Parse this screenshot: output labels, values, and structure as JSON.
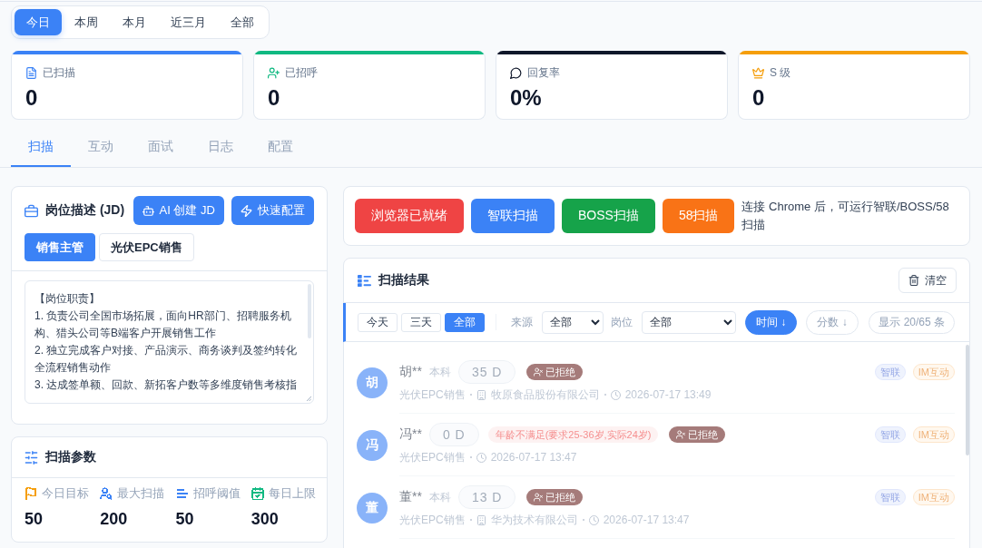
{
  "period_tabs": [
    {
      "label": "今日",
      "selected": true
    },
    {
      "label": "本周",
      "selected": false
    },
    {
      "label": "本月",
      "selected": false
    },
    {
      "label": "近三月",
      "selected": false
    },
    {
      "label": "全部",
      "selected": false
    }
  ],
  "stats": [
    {
      "label": "已扫描",
      "value": "0",
      "color": "#3b82f6"
    },
    {
      "label": "已招呼",
      "value": "0",
      "color": "#10b981"
    },
    {
      "label": "回复率",
      "value": "0%",
      "color": "#0f172a"
    },
    {
      "label": "S 级",
      "value": "0",
      "color": "#f59e0b"
    }
  ],
  "tabs": [
    {
      "label": "扫描",
      "selected": true
    },
    {
      "label": "互动",
      "selected": false
    },
    {
      "label": "面试",
      "selected": false
    },
    {
      "label": "日志",
      "selected": false
    },
    {
      "label": "配置",
      "selected": false
    }
  ],
  "jd_panel": {
    "title": "岗位描述 (JD)",
    "buttons": [
      "AI 创建 JD",
      "快速配置"
    ],
    "positions": [
      {
        "label": "销售主管",
        "selected": true
      },
      {
        "label": "光伏EPC销售",
        "selected": false
      }
    ],
    "description": "【岗位职责】\n1. 负责公司全国市场拓展，面向HR部门、招聘服务机构、猎头公司等B端客户开展销售工作\n2. 独立完成客户对接、产品演示、商务谈判及签约转化全流程销售动作\n3. 达成签单额、回款、新拓客户数等多维度销售考核指"
  },
  "scan_params": {
    "title": "扫描参数",
    "items": [
      {
        "label": "今日目标",
        "value": "50",
        "color": "#f59e0b"
      },
      {
        "label": "最大扫描",
        "value": "200",
        "color": "#3b82f6"
      },
      {
        "label": "招呼阈值",
        "value": "50",
        "color": "#3b82f6"
      },
      {
        "label": "每日上限",
        "value": "300",
        "color": "#10b981"
      }
    ]
  },
  "scan_actions": {
    "buttons": [
      {
        "label": "浏览器已就绪",
        "color": "#ef4444"
      },
      {
        "label": "智联扫描",
        "color": "#3b82f6"
      },
      {
        "label": "BOSS扫描",
        "color": "#16a34a"
      },
      {
        "label": "58扫描",
        "color": "#f97316"
      }
    ],
    "hint": "连接 Chrome 后，可运行智联/BOSS/58扫描"
  },
  "results": {
    "title": "扫描结果",
    "clear_button": "清空",
    "range_filters": [
      {
        "label": "今天",
        "selected": false
      },
      {
        "label": "三天",
        "selected": false
      },
      {
        "label": "全部",
        "selected": true
      }
    ],
    "source_label": "来源",
    "source_value": "全部",
    "position_label": "岗位",
    "position_value": "全部",
    "sorts": [
      {
        "label": "时间 ↓",
        "selected": true
      },
      {
        "label": "分数 ↓",
        "selected": false
      }
    ],
    "count": "显示 20/65 条",
    "rows": [
      {
        "avatar": "胡",
        "name": "胡**",
        "education": "本科",
        "experience": "35 D",
        "status": "已拒绝",
        "position": "光伏EPC销售",
        "company": "牧原食品股份有限公司",
        "time": "2026-07-17 13:49",
        "dimmed": true,
        "tags": [
          {
            "label": "智联",
            "kind": "source"
          },
          {
            "label": "IM互动",
            "kind": "interaction"
          }
        ]
      },
      {
        "avatar": "冯",
        "name": "冯**",
        "experience": "0 D",
        "warning": "年龄不满足(要求25-36岁,实际24岁)",
        "status": "已拒绝",
        "position": "光伏EPC销售",
        "time": "2026-07-17 13:47",
        "dimmed": true,
        "tags": [
          {
            "label": "智联",
            "kind": "source"
          },
          {
            "label": "IM互动",
            "kind": "interaction"
          }
        ]
      },
      {
        "avatar": "董",
        "name": "董**",
        "education": "本科",
        "experience": "13 D",
        "status": "已拒绝",
        "position": "光伏EPC销售",
        "company": "华为技术有限公司",
        "time": "2026-07-17 13:47",
        "dimmed": true,
        "tags": [
          {
            "label": "智联",
            "kind": "source"
          },
          {
            "label": "IM互动",
            "kind": "interaction"
          }
        ]
      }
    ]
  }
}
